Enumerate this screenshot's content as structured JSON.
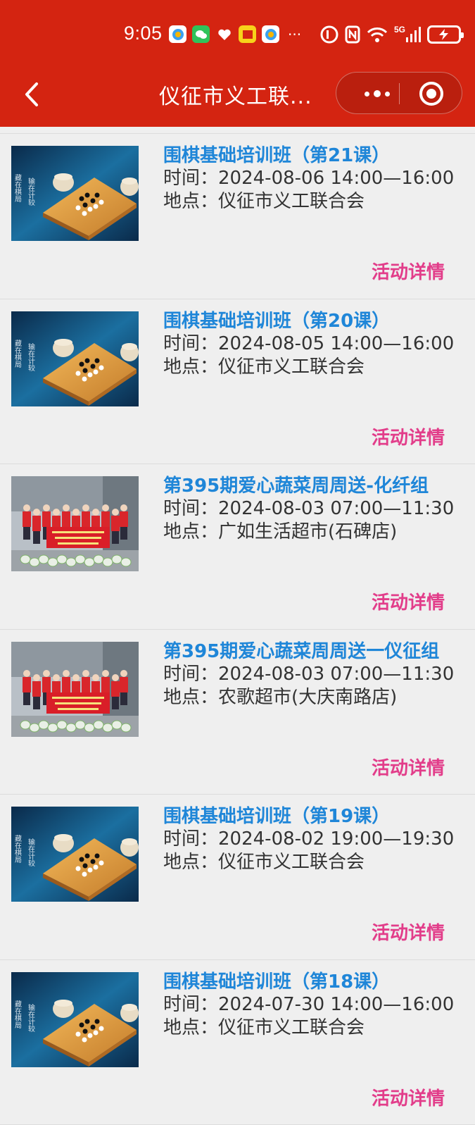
{
  "status_bar": {
    "time": "9:05",
    "more": "···",
    "network": "5G"
  },
  "nav": {
    "title": "仪征市义工联..."
  },
  "common": {
    "time_prefix": "时间：",
    "place_prefix": "地点：",
    "detail_label": "活动详情"
  },
  "activities": [
    {
      "title": "围棋基础培训班（第21课）",
      "time": "2024-08-06 14:00—16:00",
      "place": "仪征市义工联合会",
      "image": "go-board"
    },
    {
      "title": "围棋基础培训班（第20课）",
      "time": "2024-08-05 14:00—16:00",
      "place": "仪征市义工联合会",
      "image": "go-board"
    },
    {
      "title": "第395期爱心蔬菜周周送-化纤组",
      "time": "2024-08-03 07:00—11:30",
      "place": "广如生活超市(石碑店)",
      "image": "volunteer-group-photo"
    },
    {
      "title": "第395期爱心蔬菜周周送一仪征组",
      "time": "2024-08-03 07:00—11:30",
      "place": "农歌超市(大庆南路店)",
      "image": "volunteer-group-photo"
    },
    {
      "title": "围棋基础培训班（第19课）",
      "time": "2024-08-02 19:00—19:30",
      "place": "仪征市义工联合会",
      "image": "go-board"
    },
    {
      "title": "围棋基础培训班（第18课）",
      "time": "2024-07-30 14:00—16:00",
      "place": "仪征市义工联合会",
      "image": "go-board"
    }
  ],
  "colors": {
    "header": "#d42411",
    "title": "#1f86d8",
    "detail": "#e23d8a",
    "background": "#efefef"
  }
}
